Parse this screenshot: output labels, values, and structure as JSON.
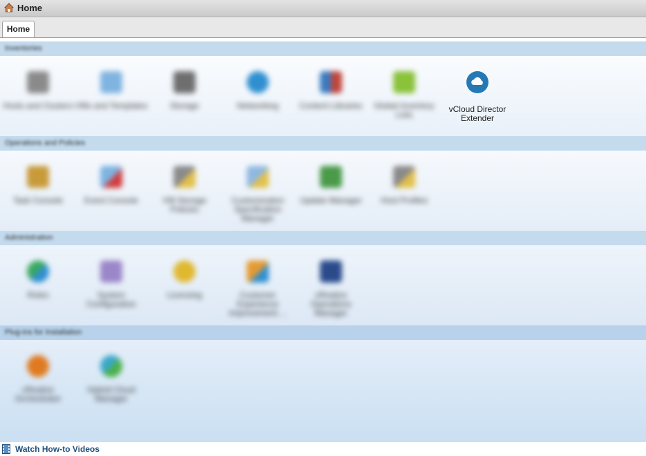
{
  "window": {
    "title": "Home"
  },
  "tabs": [
    {
      "label": "Home"
    }
  ],
  "sections": [
    {
      "name": "Inventories",
      "items": [
        {
          "label": "Hosts and Clusters",
          "icon": "hosts-clusters-icon",
          "color": "#8a8a8a"
        },
        {
          "label": "VMs and Templates",
          "icon": "vms-templates-icon",
          "color": "#7fb3e0"
        },
        {
          "label": "Storage",
          "icon": "storage-icon",
          "color": "#6e6e6e"
        },
        {
          "label": "Networking",
          "icon": "networking-icon",
          "color": "#2f8fd0"
        },
        {
          "label": "Content Libraries",
          "icon": "content-libraries-icon",
          "color": "#c0453a"
        },
        {
          "label": "Global Inventory Lists",
          "icon": "global-inventory-icon",
          "color": "#8ac23a"
        }
      ]
    },
    {
      "name": "Operations and Policies",
      "items": [
        {
          "label": "Task Console",
          "icon": "task-console-icon",
          "color": "#c89a3a"
        },
        {
          "label": "Event Console",
          "icon": "event-console-icon",
          "color": "#d23b3b"
        },
        {
          "label": "VM Storage Policies",
          "icon": "vm-storage-policies-icon",
          "color": "#e3c04a"
        },
        {
          "label": "Customization Specification Manager",
          "icon": "customization-spec-icon",
          "color": "#8fb8e0"
        },
        {
          "label": "Update Manager",
          "icon": "update-manager-icon",
          "color": "#4a9a4a"
        },
        {
          "label": "Host Profiles",
          "icon": "host-profiles-icon",
          "color": "#e3c04a"
        }
      ]
    },
    {
      "name": "Administration",
      "items": [
        {
          "label": "Roles",
          "icon": "roles-icon",
          "color": "#3aa860"
        },
        {
          "label": "System Configuration",
          "icon": "system-configuration-icon",
          "color": "#9a86c8"
        },
        {
          "label": "Licensing",
          "icon": "licensing-icon",
          "color": "#e0b830"
        },
        {
          "label": "Customer Experience Improvement ...",
          "icon": "ceip-icon",
          "color": "#e59a30"
        },
        {
          "label": "vRealize Operations Manager",
          "icon": "vrops-icon",
          "color": "#2a4a8a"
        }
      ]
    },
    {
      "name": "Plug-ins for Installation",
      "items": [
        {
          "label": "vRealize Orchestrator",
          "icon": "vro-icon",
          "color": "#e07a20"
        },
        {
          "label": "Hybrid Cloud Manager",
          "icon": "hcm-icon",
          "color": "#3aa8c8"
        }
      ]
    }
  ],
  "plugin": {
    "label": "vCloud Director Extender",
    "icon": "cloud-icon",
    "color": "#2479b5"
  },
  "footer": {
    "link": "Watch How-to Videos"
  }
}
